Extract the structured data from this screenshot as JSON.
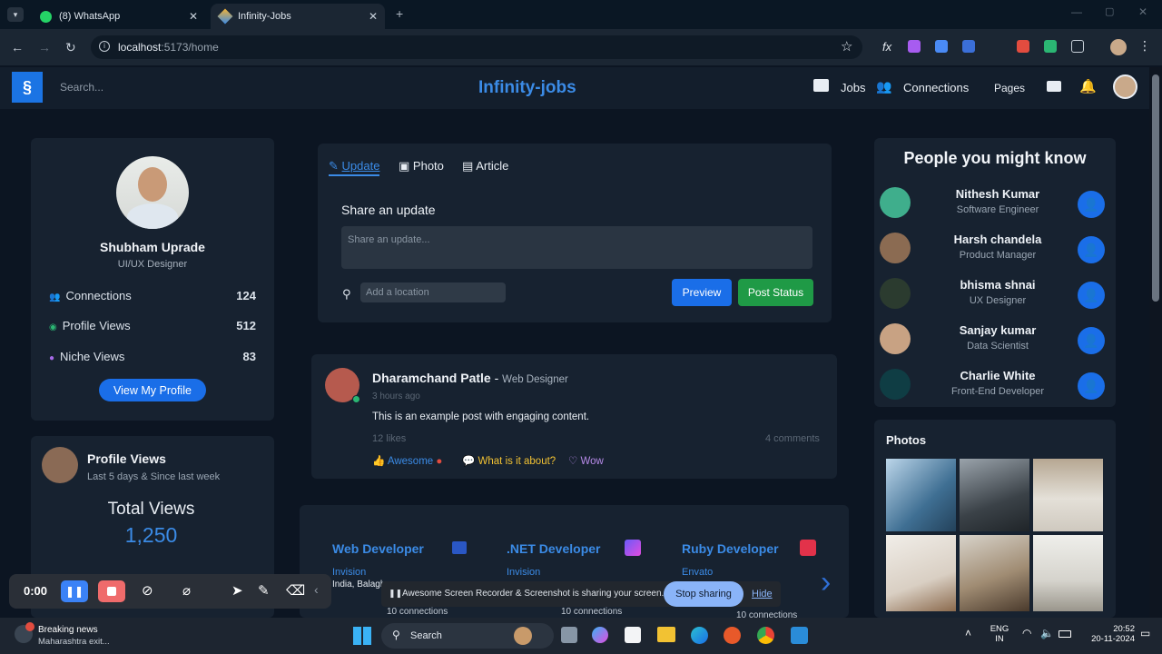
{
  "browser": {
    "tabs": [
      {
        "label": "(8) WhatsApp"
      },
      {
        "label": "Infinity-Jobs"
      }
    ],
    "url_host": "localhost",
    "url_path": ":5173/home"
  },
  "app": {
    "search_placeholder": "Search...",
    "brand": "Infinity-jobs",
    "nav": {
      "jobs": "Jobs",
      "connections": "Connections",
      "pages": "Pages"
    }
  },
  "profile": {
    "name": "Shubham Uprade",
    "role": "UI/UX Designer",
    "stats": [
      {
        "label": "Connections",
        "value": "124"
      },
      {
        "label": "Profile Views",
        "value": "512"
      },
      {
        "label": "Niche Views",
        "value": "83"
      }
    ],
    "button": "View My Profile"
  },
  "views_card": {
    "title": "Profile Views",
    "subtitle": "Last 5 days & Since last week",
    "total_label": "Total Views",
    "total_value": "1,250"
  },
  "composer": {
    "tabs": {
      "update": "Update",
      "photo": "Photo",
      "article": "Article"
    },
    "heading": "Share an update",
    "placeholder": "Share an update...",
    "location_placeholder": "Add a location",
    "preview": "Preview",
    "post": "Post Status"
  },
  "post": {
    "author": "Dharamchand Patle",
    "sep": " - ",
    "author_role": "Web Designer",
    "time": "3 hours ago",
    "content": "This is an example post with engaging content.",
    "likes": "12 likes",
    "comments": "4 comments",
    "reactions": {
      "awesome": "Awesome",
      "what": "What is it about?",
      "wow": "Wow"
    }
  },
  "jobs": [
    {
      "title": "Web Developer",
      "company": "Invision",
      "location": "India, Balagh",
      "connections": "10 connections"
    },
    {
      "title": ".NET Developer",
      "company": "Invision",
      "connections": "10 connections"
    },
    {
      "title": "Ruby Developer",
      "company": "Envato",
      "connections": "10 connections"
    }
  ],
  "people": {
    "title": "People you might know",
    "list": [
      {
        "name": "Nithesh Kumar",
        "role": "Software Engineer"
      },
      {
        "name": "Harsh chandela",
        "role": "Product Manager"
      },
      {
        "name": "bhisma shnai",
        "role": "UX Designer"
      },
      {
        "name": "Sanjay kumar",
        "role": "Data Scientist"
      },
      {
        "name": "Charlie White",
        "role": "Front-End Developer"
      }
    ]
  },
  "photos": {
    "title": "Photos"
  },
  "recorder": {
    "time": "0:00"
  },
  "share_banner": {
    "text": "Awesome Screen Recorder & Screenshot is sharing your screen.",
    "stop": "Stop sharing",
    "hide": "Hide"
  },
  "taskbar": {
    "news_title": "Breaking news",
    "news_sub": "Maharashtra exit...",
    "search": "Search",
    "lang1": "ENG",
    "lang2": "IN",
    "time": "20:52",
    "date": "20-11-2024"
  },
  "colors": {
    "accent": "#1a6ee8",
    "brand": "#3b8be6",
    "success": "#1f9a46"
  }
}
